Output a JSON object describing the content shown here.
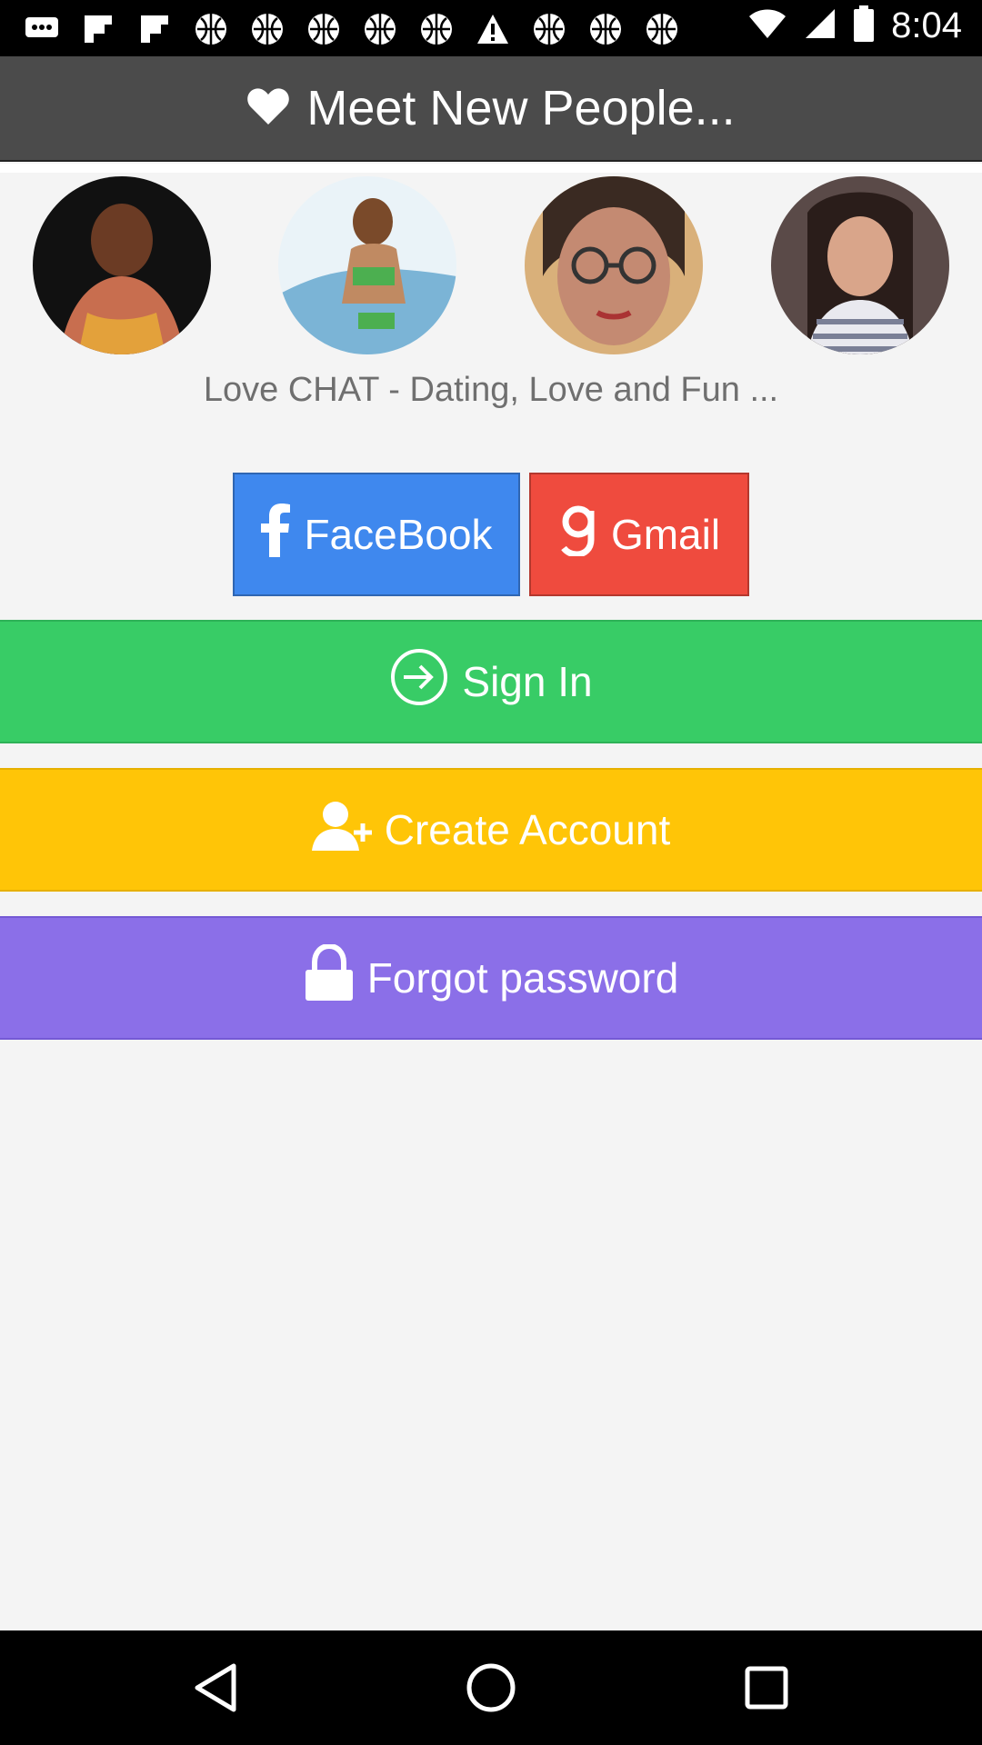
{
  "status_bar": {
    "time": "8:04",
    "notification_icons": [
      "chat-bubble-icon",
      "flipboard-icon",
      "flipboard-icon",
      "basketball-icon",
      "basketball-icon",
      "basketball-icon",
      "basketball-icon",
      "basketball-icon",
      "warning-icon",
      "basketball-icon",
      "basketball-icon",
      "basketball-icon"
    ]
  },
  "header": {
    "title": "Meet New People...",
    "icon": "heart-icon"
  },
  "avatars": [
    {
      "name": "profile-photo-1",
      "color": "#c86e4f"
    },
    {
      "name": "profile-photo-2",
      "color": "#7bb4d6"
    },
    {
      "name": "profile-photo-3",
      "color": "#b77a64"
    },
    {
      "name": "profile-photo-4",
      "color": "#5a4a48"
    }
  ],
  "subtitle": "Love CHAT - Dating, Love and Fun ...",
  "social": {
    "facebook_label": "FaceBook",
    "gmail_label": "Gmail"
  },
  "actions": {
    "sign_in": "Sign In",
    "create_account": "Create Account",
    "forgot_password": "Forgot password"
  },
  "colors": {
    "facebook": "#3f88ee",
    "gmail": "#ef4b3e",
    "sign_in": "#38cc66",
    "create_account": "#ffc507",
    "forgot_password": "#8b6fe8"
  }
}
